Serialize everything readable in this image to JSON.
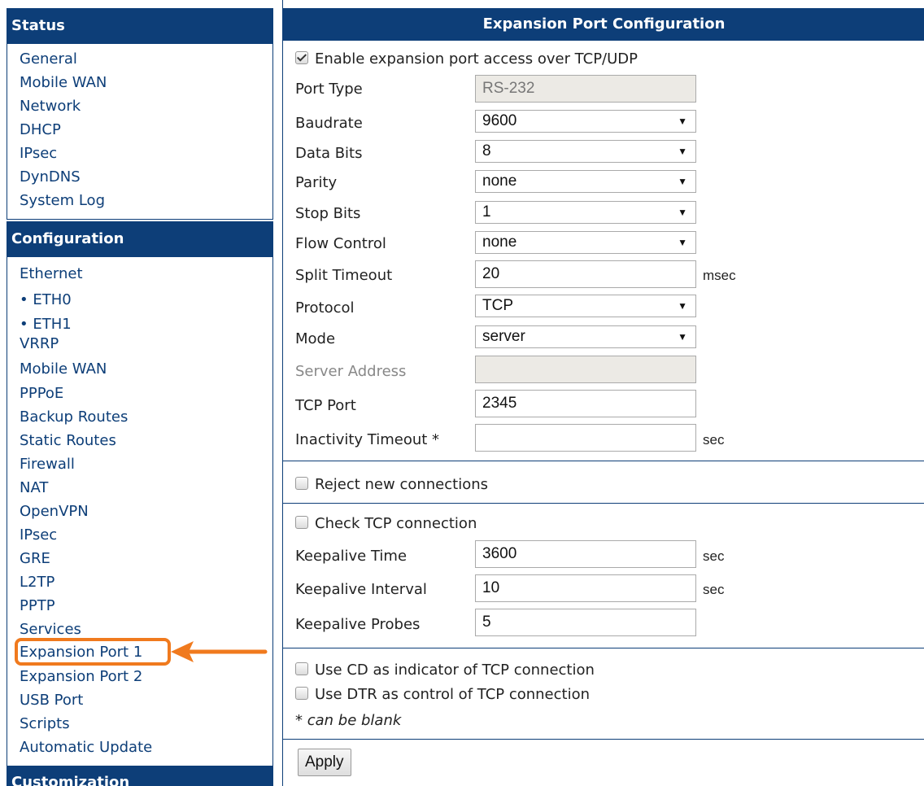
{
  "sidebar": {
    "status_title": "Status",
    "status_items": [
      "General",
      "Mobile WAN",
      "Network",
      "DHCP",
      "IPsec",
      "DynDNS",
      "System Log"
    ],
    "config_title": "Configuration",
    "config_items": [
      "Ethernet",
      "• ETH0",
      "• ETH1",
      "VRRP",
      "Mobile WAN",
      "PPPoE",
      "Backup Routes",
      "Static Routes",
      "Firewall",
      "NAT",
      "OpenVPN",
      "IPsec",
      "GRE",
      "L2TP",
      "PPTP",
      "Services",
      "Expansion Port 1",
      "Expansion Port 2",
      "USB Port",
      "Scripts",
      "Automatic Update"
    ],
    "custom_title": "Customization",
    "highlight_color": "#f07a1e"
  },
  "main": {
    "title": "Expansion Port Configuration",
    "enable_label": "Enable expansion port access over TCP/UDP",
    "enable_checked": true,
    "fields": {
      "port_type": {
        "label": "Port Type",
        "value": "RS-232"
      },
      "baudrate": {
        "label": "Baudrate",
        "value": "9600"
      },
      "data_bits": {
        "label": "Data Bits",
        "value": "8"
      },
      "parity": {
        "label": "Parity",
        "value": "none"
      },
      "stop_bits": {
        "label": "Stop Bits",
        "value": "1"
      },
      "flow_control": {
        "label": "Flow Control",
        "value": "none"
      },
      "split_timeout": {
        "label": "Split Timeout",
        "value": "20",
        "unit": "msec"
      },
      "protocol": {
        "label": "Protocol",
        "value": "TCP"
      },
      "mode": {
        "label": "Mode",
        "value": "server"
      },
      "server_address": {
        "label": "Server Address",
        "value": ""
      },
      "tcp_port": {
        "label": "TCP Port",
        "value": "2345"
      },
      "inactivity_timeout": {
        "label": "Inactivity Timeout *",
        "value": "",
        "unit": "sec"
      }
    },
    "reject_label": "Reject new connections",
    "check_tcp_label": "Check TCP connection",
    "keepalive": {
      "time": {
        "label": "Keepalive Time",
        "value": "3600",
        "unit": "sec"
      },
      "interval": {
        "label": "Keepalive Interval",
        "value": "10",
        "unit": "sec"
      },
      "probes": {
        "label": "Keepalive Probes",
        "value": "5"
      }
    },
    "cd_label": "Use CD as indicator of TCP connection",
    "dtr_label": "Use DTR as control of TCP connection",
    "note": "* can be blank",
    "apply_label": "Apply"
  },
  "colors": {
    "header": "#0d3e78",
    "link": "#0d3e78"
  }
}
